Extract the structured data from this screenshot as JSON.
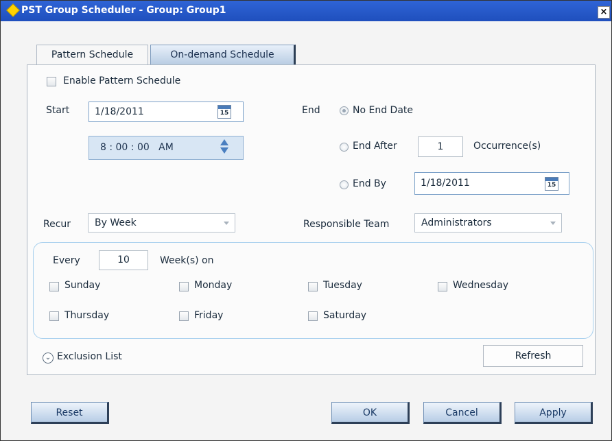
{
  "window": {
    "title": "PST Group Scheduler - Group: Group1",
    "close_glyph": "×"
  },
  "tabs": [
    {
      "label": "Pattern Schedule",
      "active": true
    },
    {
      "label": "On-demand Schedule",
      "active": false
    }
  ],
  "enable": {
    "label": "Enable Pattern Schedule",
    "checked": false
  },
  "start": {
    "label": "Start",
    "date": "1/18/2011",
    "time": "8 : 00 : 00   AM"
  },
  "calendar_icon_number": "15",
  "end": {
    "label": "End",
    "no_end_date": "No End Date",
    "end_after": "End After",
    "occurrences": "1",
    "occurrences_label": "Occurrence(s)",
    "end_by": "End By",
    "end_by_date": "1/18/2011",
    "selected": "no_end_date"
  },
  "recur": {
    "label": "Recur",
    "value": "By Week"
  },
  "team": {
    "label": "Responsible Team",
    "value": "Administrators"
  },
  "every": {
    "label": "Every",
    "value": "10",
    "unit": "Week(s) on"
  },
  "days": [
    "Sunday",
    "Monday",
    "Tuesday",
    "Wednesday",
    "Thursday",
    "Friday",
    "Saturday"
  ],
  "exclusion": {
    "label": "Exclusion List",
    "icon": "chevron-down-icon"
  },
  "buttons": {
    "refresh": "Refresh",
    "reset": "Reset",
    "ok": "OK",
    "cancel": "Cancel",
    "apply": "Apply"
  },
  "colors": {
    "titlebar": "#2f64d6",
    "accent": "#7aa0c8"
  }
}
